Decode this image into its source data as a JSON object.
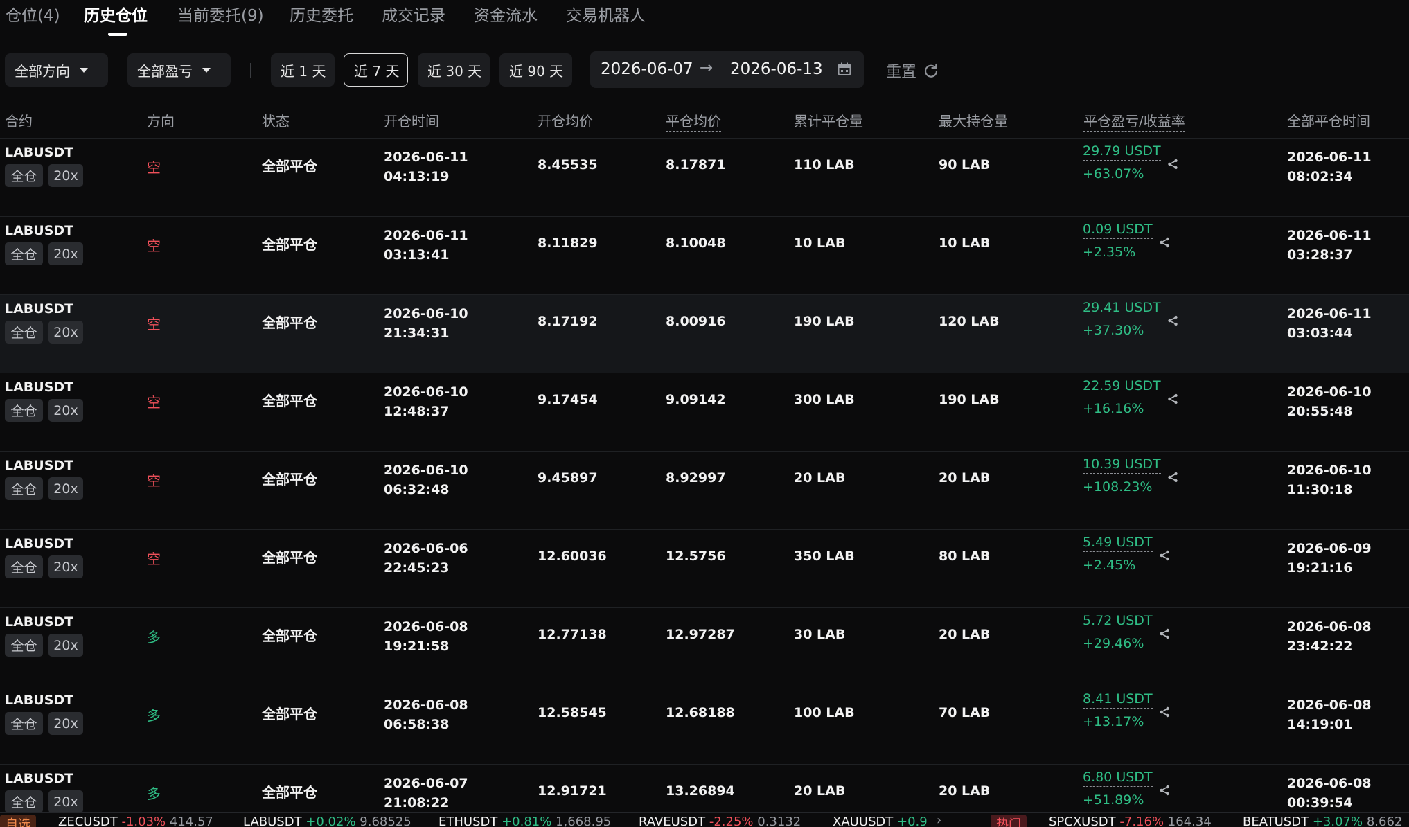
{
  "tabs": [
    {
      "label": "仓位(4)"
    },
    {
      "label": "历史仓位"
    },
    {
      "label": "当前委托(9)"
    },
    {
      "label": "历史委托"
    },
    {
      "label": "成交记录"
    },
    {
      "label": "资金流水"
    },
    {
      "label": "交易机器人"
    }
  ],
  "filters": {
    "direction": "全部方向",
    "pnl": "全部盈亏",
    "ranges": [
      "近 1 天",
      "近 7 天",
      "近 30 天",
      "近 90 天"
    ],
    "selected_range": "近 7 天",
    "date_from": "2026-06-07",
    "date_arrow": "→",
    "date_to": "2026-06-13",
    "reset": "重置"
  },
  "columns": [
    "合约",
    "方向",
    "状态",
    "开仓时间",
    "开仓均价",
    "平仓均价",
    "累计平仓量",
    "最大持仓量",
    "平仓盈亏/收益率",
    "全部平仓时间"
  ],
  "rows": [
    {
      "symbol": "LABUSDT",
      "margin": "全仓",
      "leverage": "20x",
      "side": "空",
      "side_type": "short",
      "status": "全部平仓",
      "open_date": "2026-06-11",
      "open_time": "04:13:19",
      "open_price": "8.45535",
      "close_price": "8.17871",
      "closed_qty": "110 LAB",
      "max_qty": "90 LAB",
      "pnl": "29.79 USDT",
      "roe": "+63.07%",
      "close_date": "2026-06-11",
      "close_time": "08:02:34"
    },
    {
      "symbol": "LABUSDT",
      "margin": "全仓",
      "leverage": "20x",
      "side": "空",
      "side_type": "short",
      "status": "全部平仓",
      "open_date": "2026-06-11",
      "open_time": "03:13:41",
      "open_price": "8.11829",
      "close_price": "8.10048",
      "closed_qty": "10 LAB",
      "max_qty": "10 LAB",
      "pnl": "0.09 USDT",
      "roe": "+2.35%",
      "close_date": "2026-06-11",
      "close_time": "03:28:37"
    },
    {
      "symbol": "LABUSDT",
      "margin": "全仓",
      "leverage": "20x",
      "side": "空",
      "side_type": "short",
      "status": "全部平仓",
      "open_date": "2026-06-10",
      "open_time": "21:34:31",
      "open_price": "8.17192",
      "close_price": "8.00916",
      "closed_qty": "190 LAB",
      "max_qty": "120 LAB",
      "pnl": "29.41 USDT",
      "roe": "+37.30%",
      "close_date": "2026-06-11",
      "close_time": "03:03:44"
    },
    {
      "symbol": "LABUSDT",
      "margin": "全仓",
      "leverage": "20x",
      "side": "空",
      "side_type": "short",
      "status": "全部平仓",
      "open_date": "2026-06-10",
      "open_time": "12:48:37",
      "open_price": "9.17454",
      "close_price": "9.09142",
      "closed_qty": "300 LAB",
      "max_qty": "190 LAB",
      "pnl": "22.59 USDT",
      "roe": "+16.16%",
      "close_date": "2026-06-10",
      "close_time": "20:55:48"
    },
    {
      "symbol": "LABUSDT",
      "margin": "全仓",
      "leverage": "20x",
      "side": "空",
      "side_type": "short",
      "status": "全部平仓",
      "open_date": "2026-06-10",
      "open_time": "06:32:48",
      "open_price": "9.45897",
      "close_price": "8.92997",
      "closed_qty": "20 LAB",
      "max_qty": "20 LAB",
      "pnl": "10.39 USDT",
      "roe": "+108.23%",
      "close_date": "2026-06-10",
      "close_time": "11:30:18"
    },
    {
      "symbol": "LABUSDT",
      "margin": "全仓",
      "leverage": "20x",
      "side": "空",
      "side_type": "short",
      "status": "全部平仓",
      "open_date": "2026-06-06",
      "open_time": "22:45:23",
      "open_price": "12.60036",
      "close_price": "12.5756",
      "closed_qty": "350 LAB",
      "max_qty": "80 LAB",
      "pnl": "5.49 USDT",
      "roe": "+2.45%",
      "close_date": "2026-06-09",
      "close_time": "19:21:16"
    },
    {
      "symbol": "LABUSDT",
      "margin": "全仓",
      "leverage": "20x",
      "side": "多",
      "side_type": "long",
      "status": "全部平仓",
      "open_date": "2026-06-08",
      "open_time": "19:21:58",
      "open_price": "12.77138",
      "close_price": "12.97287",
      "closed_qty": "30 LAB",
      "max_qty": "20 LAB",
      "pnl": "5.72 USDT",
      "roe": "+29.46%",
      "close_date": "2026-06-08",
      "close_time": "23:42:22"
    },
    {
      "symbol": "LABUSDT",
      "margin": "全仓",
      "leverage": "20x",
      "side": "多",
      "side_type": "long",
      "status": "全部平仓",
      "open_date": "2026-06-08",
      "open_time": "06:58:38",
      "open_price": "12.58545",
      "close_price": "12.68188",
      "closed_qty": "100 LAB",
      "max_qty": "70 LAB",
      "pnl": "8.41 USDT",
      "roe": "+13.17%",
      "close_date": "2026-06-08",
      "close_time": "14:19:01"
    },
    {
      "symbol": "LABUSDT",
      "margin": "全仓",
      "leverage": "20x",
      "side": "多",
      "side_type": "long",
      "status": "全部平仓",
      "open_date": "2026-06-07",
      "open_time": "21:08:22",
      "open_price": "12.91721",
      "close_price": "13.26894",
      "closed_qty": "20 LAB",
      "max_qty": "20 LAB",
      "pnl": "6.80 USDT",
      "roe": "+51.89%",
      "close_date": "2026-06-08",
      "close_time": "00:39:54"
    }
  ],
  "ticker": {
    "fav_label": "自选",
    "hot_label": "热门",
    "items": [
      {
        "symbol": "ZECUSDT",
        "change": "-1.03%",
        "dir": "down",
        "price": "414.57"
      },
      {
        "symbol": "LABUSDT",
        "change": "+0.02%",
        "dir": "up",
        "price": "9.68525"
      },
      {
        "symbol": "ETHUSDT",
        "change": "+0.81%",
        "dir": "up",
        "price": "1,668.95"
      },
      {
        "symbol": "RAVEUSDT",
        "change": "-2.25%",
        "dir": "down",
        "price": "0.3132"
      },
      {
        "symbol": "XAUUSDT",
        "change": "+0.9",
        "dir": "up",
        "price": ""
      }
    ],
    "hot_items": [
      {
        "symbol": "SPCXUSDT",
        "change": "-7.16%",
        "dir": "down",
        "price": "164.34"
      },
      {
        "symbol": "BEATUSDT",
        "change": "+3.07%",
        "dir": "up",
        "price": "8.662"
      }
    ]
  },
  "colors": {
    "up": "#2fbd85",
    "down": "#f0505a",
    "background": "#0b0b0c"
  }
}
